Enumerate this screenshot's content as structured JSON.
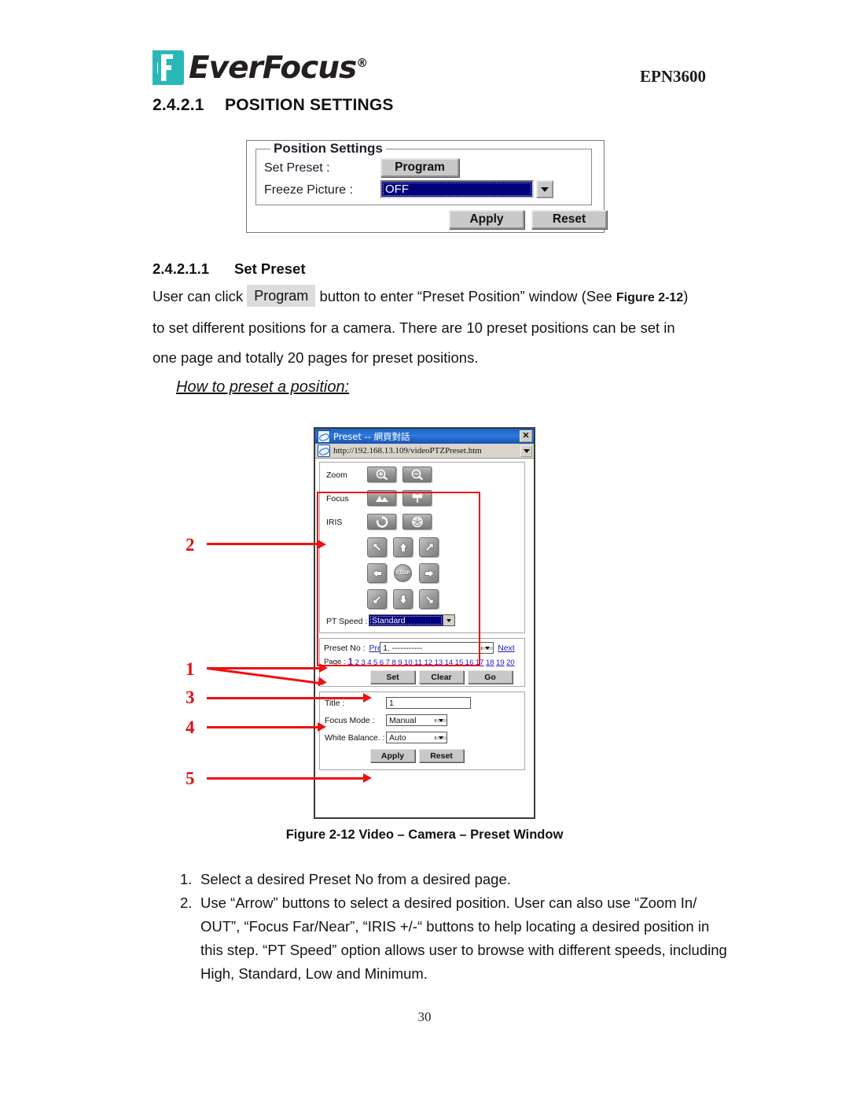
{
  "header": {
    "logo_text": "EverFocus",
    "logo_registered": "®",
    "logo_color": "#29b8b8",
    "model": "EPN3600"
  },
  "section": {
    "number": "2.4.2.1",
    "title": "POSITION SETTINGS"
  },
  "position_settings_panel": {
    "legend": "Position Settings",
    "set_preset_label": "Set Preset :",
    "program_button": "Program",
    "freeze_picture_label": "Freeze Picture :",
    "freeze_picture_value": "OFF",
    "apply_button": "Apply",
    "reset_button": "Reset"
  },
  "subsection": {
    "number": "2.4.2.1.1",
    "title": "Set Preset",
    "para_part1": "User can click",
    "para_button": "Program",
    "para_part2": "button to enter “Preset Position” window (See",
    "para_figref": "Figure 2-12",
    "para_part3": ") to set different positions for a camera. There are 10 preset positions can be set in one page and totally 20 pages for preset positions.",
    "howto": "How to preset a position:"
  },
  "preset_window": {
    "title": "Preset -- 網頁對話",
    "close_label": "✕",
    "address": "http://192.168.13.109/videoPTZPreset.htm",
    "ptz": {
      "zoom_label": "Zoom",
      "focus_label": "Focus",
      "iris_label": "IRIS",
      "zoom_in_icon": "zoom-in-icon",
      "zoom_out_icon": "zoom-out-icon",
      "focus_far_icon": "focus-far-icon",
      "focus_near_icon": "focus-near-icon",
      "iris_open_icon": "iris-open-icon",
      "iris_close_icon": "iris-close-icon",
      "stop_label": "STOP",
      "pt_speed_label": "PT Speed :",
      "pt_speed_value": "Standard"
    },
    "preset_row": {
      "label": "Preset No :",
      "prev_link": "Prev",
      "select_value": "1. -----------",
      "next_link": "Next",
      "page_label": "Page :",
      "pages": [
        "1",
        "2",
        "3",
        "4",
        "5",
        "6",
        "7",
        "8",
        "9",
        "10",
        "11",
        "12",
        "13",
        "14",
        "15",
        "16",
        "17",
        "18",
        "19",
        "20"
      ],
      "current_page": "1",
      "set_button": "Set",
      "clear_button": "Clear",
      "go_button": "Go"
    },
    "detail": {
      "title_label": "Title :",
      "title_value": "1",
      "focus_mode_label": "Focus Mode :",
      "focus_mode_value": "Manual",
      "white_balance_label": "White Balance. :",
      "white_balance_value": "Auto",
      "apply_button": "Apply",
      "reset_button": "Reset"
    }
  },
  "callouts": {
    "c1": "1",
    "c2": "2",
    "c3": "3",
    "c4": "4",
    "c5": "5",
    "color": "#ee1111"
  },
  "figure_caption": "Figure 2-12 Video – Camera – Preset Window",
  "steps": [
    {
      "marker": "1.",
      "text": "Select a desired Preset No from a desired page."
    },
    {
      "marker": "2.",
      "text": "Use “Arrow” buttons to select a desired position. User can also use “Zoom In/ OUT”, “Focus Far/Near”, “IRIS +/-“ buttons to help locating a desired position in this step. “PT Speed” option allows user to browse with different speeds, including High, Standard, Low and Minimum."
    }
  ],
  "page_number": "30"
}
